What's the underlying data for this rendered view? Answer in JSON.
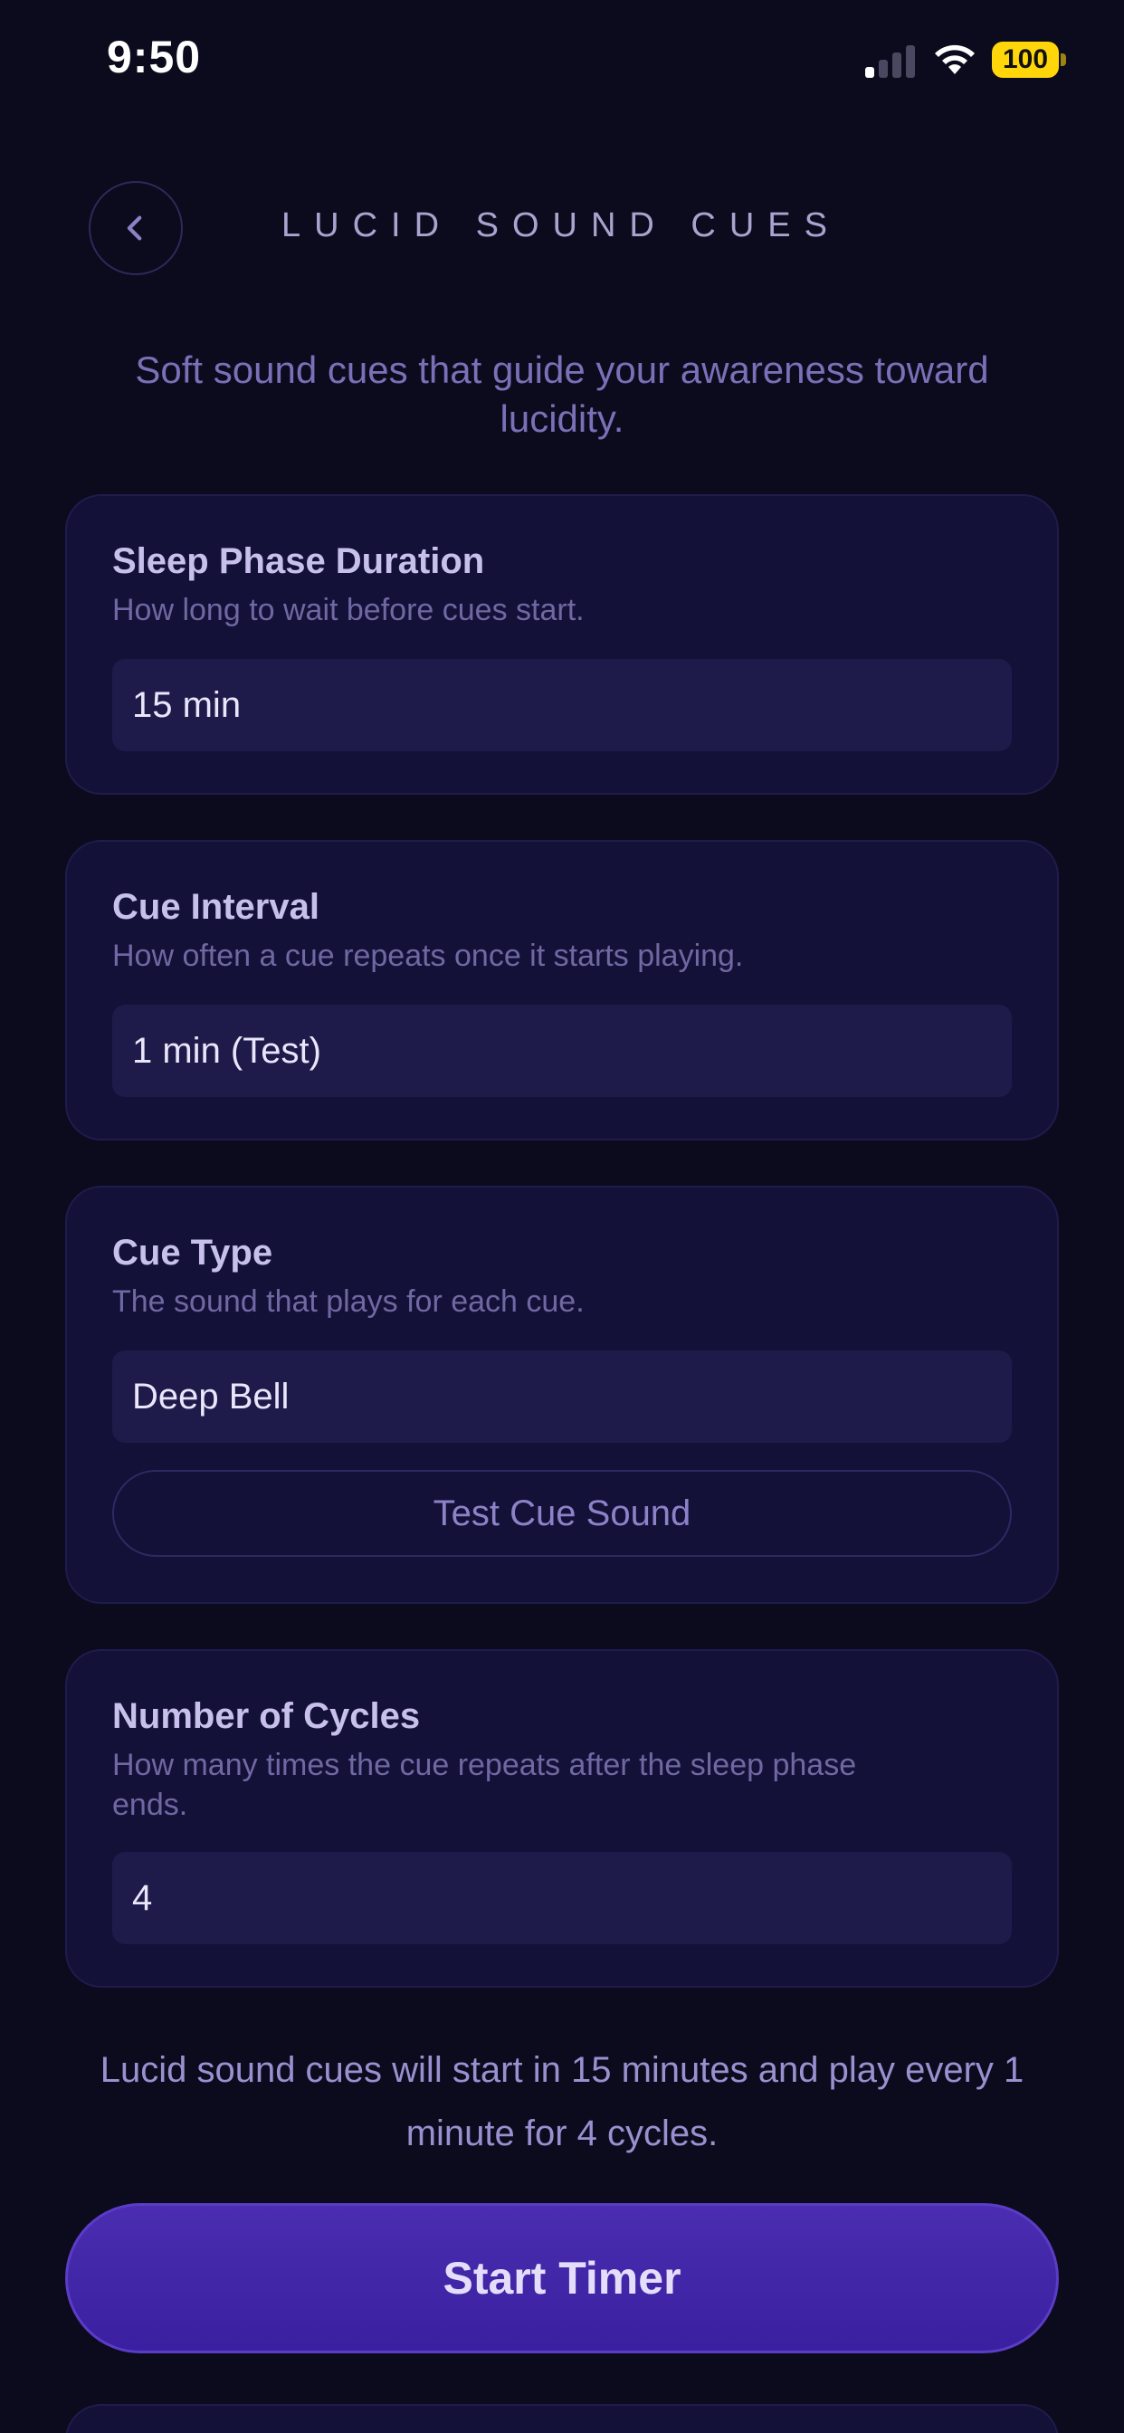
{
  "status_bar": {
    "time": "9:50",
    "battery": "100"
  },
  "header": {
    "title": "LUCID SOUND CUES"
  },
  "subtitle": "Soft sound cues that guide your awareness toward lucidity.",
  "cards": {
    "sleep_phase": {
      "title": "Sleep Phase Duration",
      "description": "How long to wait before cues start.",
      "value": "15 min"
    },
    "cue_interval": {
      "title": "Cue Interval",
      "description": "How often a cue repeats once it starts playing.",
      "value": "1 min (Test)"
    },
    "cue_type": {
      "title": "Cue Type",
      "description": "The sound that plays for each cue.",
      "value": "Deep Bell",
      "test_button": "Test Cue Sound"
    },
    "cycles": {
      "title": "Number of Cycles",
      "description": "How many times the cue repeats after the sleep phase ends.",
      "value": "4"
    }
  },
  "summary": "Lucid sound cues will start in 15 minutes and play every 1 minute for 4 cycles.",
  "start_button": "Start Timer",
  "colors": {
    "background": "#0c0a1d",
    "card": "#131137",
    "field": "#1e1b4b",
    "accent": "#4a2db0",
    "battery": "#ffd60a"
  }
}
